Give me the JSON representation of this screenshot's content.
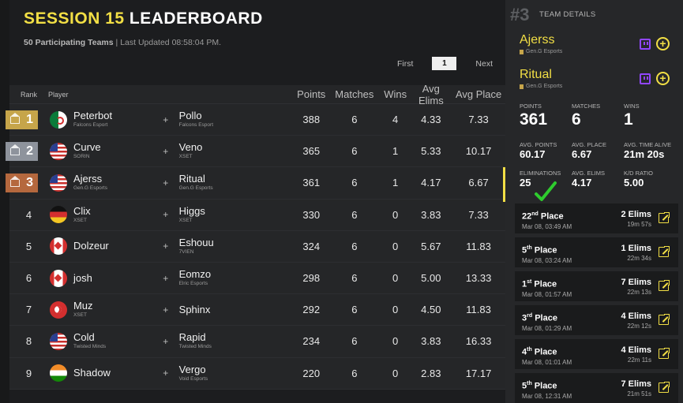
{
  "header": {
    "title_prefix": "SESSION 15",
    "title_suffix": "LEADERBOARD",
    "teams_count": "50 Participating Teams",
    "separator": "|",
    "last_updated": "Last Updated 08:58:04 PM."
  },
  "pagination": {
    "first": "First",
    "current": "1",
    "next": "Next"
  },
  "table": {
    "headers": {
      "rank": "Rank",
      "player": "Player",
      "points": "Points",
      "matches": "Matches",
      "wins": "Wins",
      "avg_elims": "Avg Elims",
      "avg_place": "Avg Place"
    },
    "rows": [
      {
        "rank": "1",
        "medal": "gold",
        "flag": "dz",
        "p1": "Peterbot",
        "t1": "Falcons Esport",
        "p2": "Pollo",
        "t2": "Falcons Esport",
        "points": "388",
        "matches": "6",
        "wins": "4",
        "avg_elims": "4.33",
        "avg_place": "7.33"
      },
      {
        "rank": "2",
        "medal": "silver",
        "flag": "us",
        "p1": "Curve",
        "t1": "SORIN",
        "p2": "Veno",
        "t2": "XSET",
        "points": "365",
        "matches": "6",
        "wins": "1",
        "avg_elims": "5.33",
        "avg_place": "10.17"
      },
      {
        "rank": "3",
        "medal": "bronze",
        "flag": "us",
        "p1": "Ajerss",
        "t1": "Gen.G Esports",
        "p2": "Ritual",
        "t2": "Gen.G Esports",
        "points": "361",
        "matches": "6",
        "wins": "1",
        "avg_elims": "4.17",
        "avg_place": "6.67"
      },
      {
        "rank": "4",
        "medal": "",
        "flag": "de",
        "p1": "Clix",
        "t1": "XSET",
        "p2": "Higgs",
        "t2": "XSET",
        "points": "330",
        "matches": "6",
        "wins": "0",
        "avg_elims": "3.83",
        "avg_place": "7.33"
      },
      {
        "rank": "5",
        "medal": "",
        "flag": "ca",
        "p1": "Dolzeur",
        "t1": "",
        "p2": "Eshouu",
        "t2": "7VIEN",
        "points": "324",
        "matches": "6",
        "wins": "0",
        "avg_elims": "5.67",
        "avg_place": "11.83"
      },
      {
        "rank": "6",
        "medal": "",
        "flag": "ca",
        "p1": "josh",
        "t1": "",
        "p2": "Eomzo",
        "t2": "Elric Esports",
        "points": "298",
        "matches": "6",
        "wins": "0",
        "avg_elims": "5.00",
        "avg_place": "13.33"
      },
      {
        "rank": "7",
        "medal": "",
        "flag": "tr",
        "p1": "Muz",
        "t1": "XSET",
        "p2": "Sphinx",
        "t2": "",
        "points": "292",
        "matches": "6",
        "wins": "0",
        "avg_elims": "4.50",
        "avg_place": "11.83"
      },
      {
        "rank": "8",
        "medal": "",
        "flag": "us",
        "p1": "Cold",
        "t1": "Twisted Minds",
        "p2": "Rapid",
        "t2": "Twisted Minds",
        "points": "234",
        "matches": "6",
        "wins": "0",
        "avg_elims": "3.83",
        "avg_place": "16.33"
      },
      {
        "rank": "9",
        "medal": "",
        "flag": "in",
        "p1": "Shadow",
        "t1": "",
        "p2": "Vergo",
        "t2": "Void Esports",
        "points": "220",
        "matches": "6",
        "wins": "0",
        "avg_elims": "2.83",
        "avg_place": "17.17"
      }
    ]
  },
  "team_details": {
    "rank": "#3",
    "label": "TEAM DETAILS",
    "players": [
      {
        "name": "Ajerss",
        "team": "Gen.G Esports"
      },
      {
        "name": "Ritual",
        "team": "Gen.G Esports"
      }
    ],
    "stats": {
      "points_label": "POINTS",
      "points": "361",
      "matches_label": "MATCHES",
      "matches": "6",
      "wins_label": "WINS",
      "wins": "1",
      "avg_points_label": "AVG. POINTS",
      "avg_points": "60.17",
      "avg_place_label": "AVG. PLACE",
      "avg_place": "6.67",
      "avg_time_label": "AVG. TIME ALIVE",
      "avg_time": "21m 20s",
      "elims_label": "ELIMINATIONS",
      "elims": "25",
      "avg_elims_label": "AVG. ELIMS",
      "avg_elims": "4.17",
      "kd_label": "K/D RATIO",
      "kd": "5.00"
    },
    "matches": [
      {
        "place_num": "22",
        "place_suffix": "nd",
        "place_word": "Place",
        "date": "Mar 08, 03:49 AM",
        "elims": "2 Elims",
        "time": "19m 57s"
      },
      {
        "place_num": "5",
        "place_suffix": "th",
        "place_word": "Place",
        "date": "Mar 08, 03:24 AM",
        "elims": "1 Elims",
        "time": "22m 34s"
      },
      {
        "place_num": "1",
        "place_suffix": "st",
        "place_word": "Place",
        "date": "Mar 08, 01:57 AM",
        "elims": "7 Elims",
        "time": "22m 13s"
      },
      {
        "place_num": "3",
        "place_suffix": "rd",
        "place_word": "Place",
        "date": "Mar 08, 01:29 AM",
        "elims": "4 Elims",
        "time": "22m 12s"
      },
      {
        "place_num": "4",
        "place_suffix": "th",
        "place_word": "Place",
        "date": "Mar 08, 01:01 AM",
        "elims": "4 Elims",
        "time": "22m 11s"
      },
      {
        "place_num": "5",
        "place_suffix": "th",
        "place_word": "Place",
        "date": "Mar 08, 12:31 AM",
        "elims": "7 Elims",
        "time": "21m 51s"
      }
    ]
  },
  "colors": {
    "accent": "#f2df45",
    "gold": "#c6a54a",
    "silver": "#8e939c",
    "bronze": "#b5683e",
    "twitch": "#9146ff",
    "annotation": "#2ecc2e"
  }
}
